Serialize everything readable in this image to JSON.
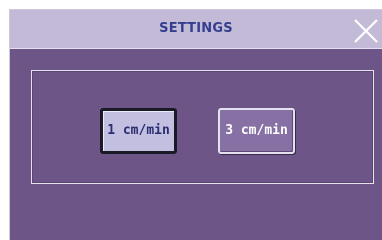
{
  "dialog": {
    "title": "SETTINGS",
    "close_icon": "close-x-icon"
  },
  "options": [
    {
      "label": "1 cm/min",
      "selected": true
    },
    {
      "label": "3 cm/min",
      "selected": false
    }
  ],
  "colors": {
    "dialog_bg": "#6d5588",
    "titlebar_bg": "#c2bad6",
    "title_text": "#333f8e",
    "selected_bg": "#c3bfe1",
    "unselected_bg": "#8771a4"
  }
}
